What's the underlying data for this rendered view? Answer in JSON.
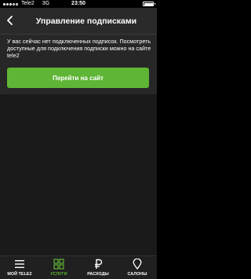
{
  "status_bar": {
    "carrier": "Tele2",
    "network": "3G",
    "time": "23:50",
    "signal_bars": 3,
    "battery_level": 1.0
  },
  "header": {
    "title": "Управление подписками",
    "back_icon": "chevron-left-icon"
  },
  "main": {
    "message": "У вас сейчас нет подключенных подписок. Посмотреть доступные для подключения подписки можно на сайте tele2",
    "button_label": "Перейти на сайт"
  },
  "tab_bar": {
    "tabs": [
      {
        "label": "МОЙ TELE2",
        "icon": "hamburger-menu-icon",
        "active": false
      },
      {
        "label": "УСЛУГИ",
        "icon": "grid-icon",
        "active": true
      },
      {
        "label": "РАСХОДЫ",
        "icon": "ruble-icon",
        "active": false
      },
      {
        "label": "САЛОНЫ",
        "icon": "map-pin-icon",
        "active": false
      }
    ]
  },
  "colors": {
    "accent": "#5fb536",
    "background": "#1a1a1a",
    "header": "#2a2a2a",
    "tab_bar": "#202020"
  }
}
